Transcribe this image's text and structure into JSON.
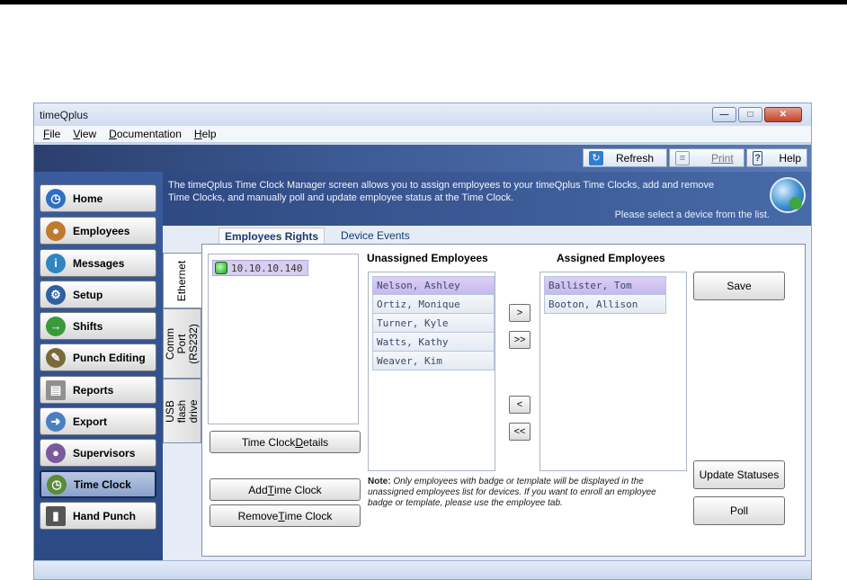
{
  "window": {
    "title": "timeQplus"
  },
  "menu": [
    {
      "label": "File",
      "key": "F",
      "rest": "ile"
    },
    {
      "label": "View",
      "key": "V",
      "rest": "iew"
    },
    {
      "label": "Documentation",
      "key": "D",
      "rest": "ocumentation"
    },
    {
      "label": "Help",
      "key": "H",
      "rest": "elp"
    }
  ],
  "toolbar": {
    "refresh": "Refresh",
    "print": "Print",
    "help": "Help"
  },
  "sidebar": [
    {
      "label": "Home",
      "icon": "clock-icon",
      "color": "#2f6fc0"
    },
    {
      "label": "Employees",
      "icon": "person-icon",
      "color": "#c07a2f"
    },
    {
      "label": "Messages",
      "icon": "info-icon",
      "color": "#2f86c0"
    },
    {
      "label": "Setup",
      "icon": "gear-icon",
      "color": "#3060a0"
    },
    {
      "label": "Shifts",
      "icon": "shift-icon",
      "color": "#3a9a3a"
    },
    {
      "label": "Punch Editing",
      "icon": "pencil-icon",
      "color": "#7a6a3a"
    },
    {
      "label": "Reports",
      "icon": "document-icon",
      "color": "#909090"
    },
    {
      "label": "Export",
      "icon": "export-arrow-icon",
      "color": "#4a80c0"
    },
    {
      "label": "Supervisors",
      "icon": "people-icon",
      "color": "#7a5a9a"
    },
    {
      "label": "Time Clock",
      "icon": "time-clock-icon",
      "color": "#5a8a3a"
    },
    {
      "label": "Hand Punch",
      "icon": "hand-punch-icon",
      "color": "#555555"
    }
  ],
  "info": {
    "description": "The timeQplus Time Clock Manager screen allows you to assign employees to your timeQplus Time Clocks, add and remove Time Clocks, and manually poll and update employee status at the Time Clock.",
    "hint": "Please select a device from the list."
  },
  "vtabs": [
    "Ethernet",
    "Comm Port (RS232)",
    "USB flash drive"
  ],
  "htabs": [
    "Employees Rights",
    "Device Events"
  ],
  "devices": [
    {
      "address": "10.10.10.140",
      "status_color": "#1aa01a"
    }
  ],
  "buttons": {
    "details_pre": "Time Clock ",
    "details_key": "D",
    "details_post": "etails",
    "add_pre": "Add ",
    "add_key": "T",
    "add_post": "ime Clock",
    "remove_pre": "Remove ",
    "remove_key": "T",
    "remove_post": "ime Clock",
    "save": "Save",
    "update": "Update Statuses",
    "poll": "Poll",
    "move_right": ">",
    "move_all_right": ">>",
    "move_left": "<",
    "move_all_left": "<<"
  },
  "unassigned": {
    "label": "Unassigned Employees",
    "items": [
      "Nelson, Ashley",
      "Ortiz, Monique",
      "Turner, Kyle",
      "Watts, Kathy",
      "Weaver, Kim"
    ]
  },
  "assigned": {
    "label": "Assigned Employees",
    "items": [
      "Ballister, Tom",
      "Booton, Allison"
    ]
  },
  "note": {
    "label": "Note:",
    "text": "Only employees with badge or template will be displayed in the unassigned employees list for devices. If you want to enroll an employee badge or template, please use the employee tab."
  }
}
